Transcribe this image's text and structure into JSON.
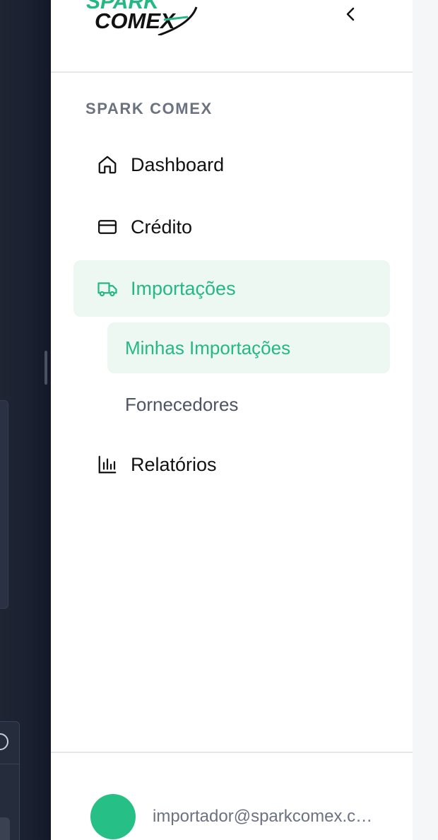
{
  "logo": {
    "top_text": "SPARK",
    "bottom_text": "COMEX"
  },
  "header": {
    "collapse_icon": "chevron-left-icon"
  },
  "sidebar": {
    "section_label": "SPARK COMEX",
    "items": [
      {
        "label": "Dashboard",
        "icon": "home-icon",
        "active": false
      },
      {
        "label": "Crédito",
        "icon": "credit-card-icon",
        "active": false
      },
      {
        "label": "Importações",
        "icon": "truck-icon",
        "active": true,
        "subitems": [
          {
            "label": "Minhas Importações",
            "active": true
          },
          {
            "label": "Fornecedores",
            "active": false
          }
        ]
      },
      {
        "label": "Relatórios",
        "icon": "bar-chart-icon",
        "active": false
      }
    ]
  },
  "user": {
    "email": "importador@sparkcomex.com.br"
  },
  "colors": {
    "accent": "#26B883",
    "accent_bg": "#EDF8F3",
    "avatar": "#26C086",
    "backdrop": "#1F2533"
  }
}
